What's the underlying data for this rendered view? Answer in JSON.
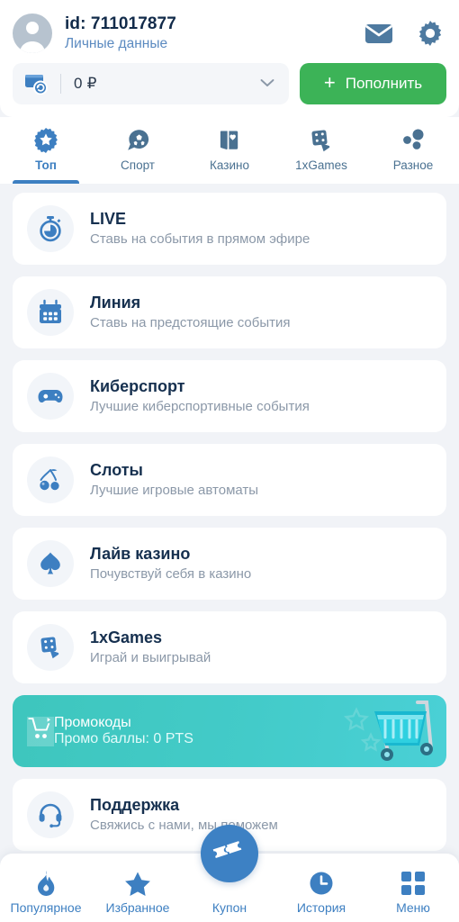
{
  "header": {
    "avatar_icon": "user-avatar-icon",
    "id_label": "id:",
    "id_value": "711017877",
    "personal_data_link": "Личные данные",
    "mail_icon": "mail-icon",
    "settings_icon": "gear-icon",
    "wallet_icon": "wallet-refresh-icon",
    "balance": "0 ₽",
    "dropdown_icon": "chevron-down-icon",
    "topup_plus": "+",
    "topup_label": "Пополнить",
    "topup_color": "#3cb357"
  },
  "tabs": [
    {
      "label": "Топ",
      "icon": "rosette-star-icon",
      "active": true
    },
    {
      "label": "Спорт",
      "icon": "soccer-ball-icon",
      "active": false
    },
    {
      "label": "Казино",
      "icon": "playing-cards-icon",
      "active": false
    },
    {
      "label": "1xGames",
      "icon": "dice-icon",
      "active": false
    },
    {
      "label": "Разное",
      "icon": "dots-cluster-icon",
      "active": false
    }
  ],
  "list": [
    {
      "title": "LIVE",
      "subtitle": "Ставь на события в прямом эфире",
      "icon": "stopwatch-icon"
    },
    {
      "title": "Линия",
      "subtitle": "Ставь на предстоящие события",
      "icon": "calendar-icon"
    },
    {
      "title": "Киберспорт",
      "subtitle": "Лучшие киберспортивные события",
      "icon": "gamepad-icon"
    },
    {
      "title": "Слоты",
      "subtitle": "Лучшие игровые автоматы",
      "icon": "cherries-icon"
    },
    {
      "title": "Лайв казино",
      "subtitle": "Почувствуй себя в казино",
      "icon": "spade-icon"
    },
    {
      "title": "1xGames",
      "subtitle": "Играй и выигрывай",
      "icon": "dice-icon"
    }
  ],
  "promo": {
    "title": "Промокоды",
    "subtitle": "Промо баллы: 0 PTS",
    "icon": "shopping-cart-icon",
    "art": "shopping-cart-illustration",
    "color_start": "#3ec6bd",
    "color_end": "#4ad0d6"
  },
  "support": {
    "title": "Поддержка",
    "subtitle": "Свяжись с нами, мы поможем",
    "icon": "headset-icon"
  },
  "bottom_nav": [
    {
      "label": "Популярное",
      "icon": "flame-icon"
    },
    {
      "label": "Избранное",
      "icon": "star-icon"
    },
    {
      "label": "Купон",
      "icon": "ticket-icon"
    },
    {
      "label": "История",
      "icon": "clock-icon"
    },
    {
      "label": "Меню",
      "icon": "grid-squares-icon"
    }
  ]
}
